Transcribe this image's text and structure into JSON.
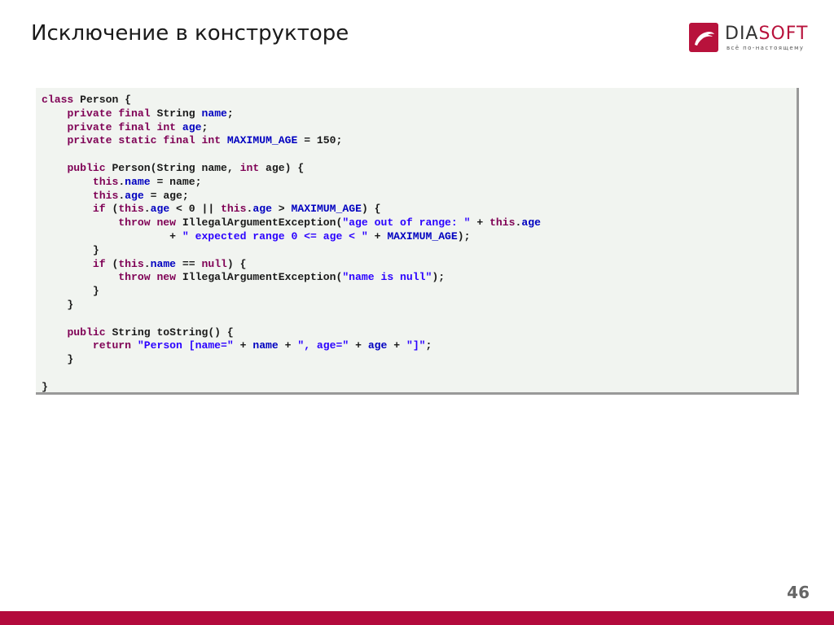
{
  "slide": {
    "title": "Исключение в конструкторе",
    "page_number": "46"
  },
  "logo": {
    "word_prefix": "DIA",
    "word_suffix": "SOFT",
    "tagline": "всё по-настоящему",
    "icon": "dolphin-icon"
  },
  "colors": {
    "brand": "#b8123c",
    "bottom_bar": "#b30a3c",
    "code_background": "#f1f4f0",
    "keyword": "#7f0055",
    "field": "#0000c0",
    "string": "#2a00ff"
  },
  "code": {
    "language": "java",
    "lines": [
      [
        [
          "kw",
          "class"
        ],
        [
          "t",
          " Person {"
        ]
      ],
      [
        [
          "t",
          "    "
        ],
        [
          "kw",
          "private"
        ],
        [
          "t",
          " "
        ],
        [
          "kw",
          "final"
        ],
        [
          "t",
          " String "
        ],
        [
          "fld",
          "name"
        ],
        [
          "t",
          ";"
        ]
      ],
      [
        [
          "t",
          "    "
        ],
        [
          "kw",
          "private"
        ],
        [
          "t",
          " "
        ],
        [
          "kw",
          "final"
        ],
        [
          "t",
          " "
        ],
        [
          "kw",
          "int"
        ],
        [
          "t",
          " "
        ],
        [
          "fld",
          "age"
        ],
        [
          "t",
          ";"
        ]
      ],
      [
        [
          "t",
          "    "
        ],
        [
          "kw",
          "private"
        ],
        [
          "t",
          " "
        ],
        [
          "kw",
          "static"
        ],
        [
          "t",
          " "
        ],
        [
          "kw",
          "final"
        ],
        [
          "t",
          " "
        ],
        [
          "kw",
          "int"
        ],
        [
          "t",
          " "
        ],
        [
          "fld",
          "MAXIMUM_AGE"
        ],
        [
          "t",
          " = 150;"
        ]
      ],
      [
        [
          "t",
          ""
        ]
      ],
      [
        [
          "t",
          "    "
        ],
        [
          "kw",
          "public"
        ],
        [
          "t",
          " Person(String name, "
        ],
        [
          "kw",
          "int"
        ],
        [
          "t",
          " age) {"
        ]
      ],
      [
        [
          "t",
          "        "
        ],
        [
          "kw",
          "this"
        ],
        [
          "t",
          "."
        ],
        [
          "fld",
          "name"
        ],
        [
          "t",
          " = name;"
        ]
      ],
      [
        [
          "t",
          "        "
        ],
        [
          "kw",
          "this"
        ],
        [
          "t",
          "."
        ],
        [
          "fld",
          "age"
        ],
        [
          "t",
          " = age;"
        ]
      ],
      [
        [
          "t",
          "        "
        ],
        [
          "kw",
          "if"
        ],
        [
          "t",
          " ("
        ],
        [
          "kw",
          "this"
        ],
        [
          "t",
          "."
        ],
        [
          "fld",
          "age"
        ],
        [
          "t",
          " < 0 || "
        ],
        [
          "kw",
          "this"
        ],
        [
          "t",
          "."
        ],
        [
          "fld",
          "age"
        ],
        [
          "t",
          " > "
        ],
        [
          "fld",
          "MAXIMUM_AGE"
        ],
        [
          "t",
          ") {"
        ]
      ],
      [
        [
          "t",
          "            "
        ],
        [
          "kw",
          "throw"
        ],
        [
          "t",
          " "
        ],
        [
          "kw",
          "new"
        ],
        [
          "t",
          " IllegalArgumentException("
        ],
        [
          "str",
          "\"age out of range: \""
        ],
        [
          "t",
          " + "
        ],
        [
          "kw",
          "this"
        ],
        [
          "t",
          "."
        ],
        [
          "fld",
          "age"
        ]
      ],
      [
        [
          "t",
          "                    + "
        ],
        [
          "str",
          "\" expected range 0 <= age < \""
        ],
        [
          "t",
          " + "
        ],
        [
          "fld",
          "MAXIMUM_AGE"
        ],
        [
          "t",
          ");"
        ]
      ],
      [
        [
          "t",
          "        }"
        ]
      ],
      [
        [
          "t",
          "        "
        ],
        [
          "kw",
          "if"
        ],
        [
          "t",
          " ("
        ],
        [
          "kw",
          "this"
        ],
        [
          "t",
          "."
        ],
        [
          "fld",
          "name"
        ],
        [
          "t",
          " == "
        ],
        [
          "kw",
          "null"
        ],
        [
          "t",
          ") {"
        ]
      ],
      [
        [
          "t",
          "            "
        ],
        [
          "kw",
          "throw"
        ],
        [
          "t",
          " "
        ],
        [
          "kw",
          "new"
        ],
        [
          "t",
          " IllegalArgumentException("
        ],
        [
          "str",
          "\"name is null\""
        ],
        [
          "t",
          ");"
        ]
      ],
      [
        [
          "t",
          "        }"
        ]
      ],
      [
        [
          "t",
          "    }"
        ]
      ],
      [
        [
          "t",
          ""
        ]
      ],
      [
        [
          "t",
          "    "
        ],
        [
          "kw",
          "public"
        ],
        [
          "t",
          " String toString() {"
        ]
      ],
      [
        [
          "t",
          "        "
        ],
        [
          "kw",
          "return"
        ],
        [
          "t",
          " "
        ],
        [
          "str",
          "\"Person [name=\""
        ],
        [
          "t",
          " + "
        ],
        [
          "fld",
          "name"
        ],
        [
          "t",
          " + "
        ],
        [
          "str",
          "\", age=\""
        ],
        [
          "t",
          " + "
        ],
        [
          "fld",
          "age"
        ],
        [
          "t",
          " + "
        ],
        [
          "str",
          "\"]\""
        ],
        [
          "t",
          ";"
        ]
      ],
      [
        [
          "t",
          "    }"
        ]
      ],
      [
        [
          "t",
          ""
        ]
      ],
      [
        [
          "t",
          "}"
        ]
      ]
    ]
  }
}
